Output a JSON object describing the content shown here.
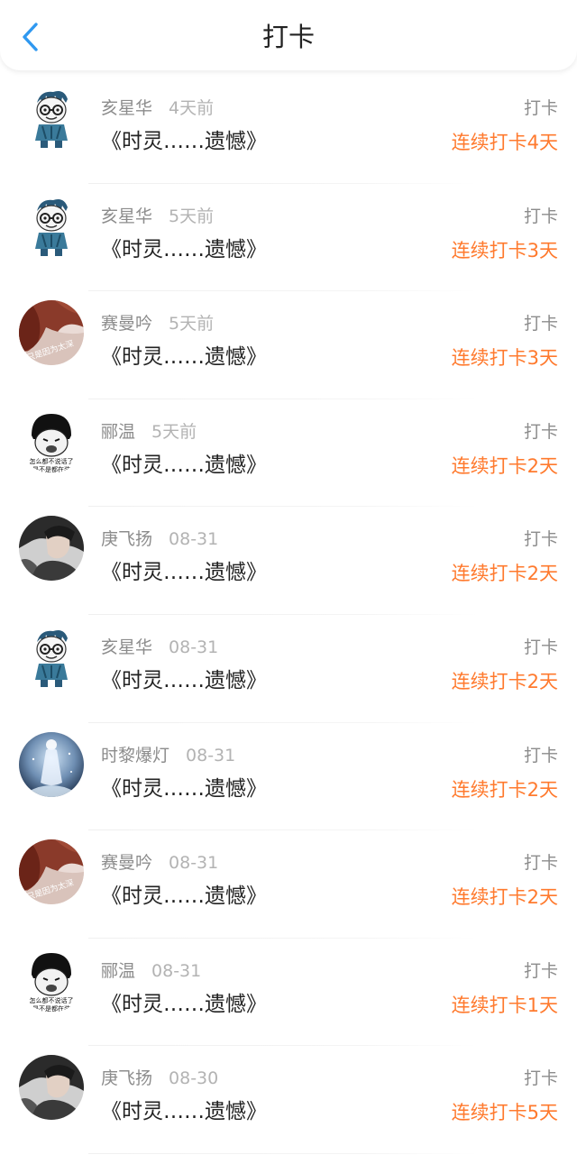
{
  "header": {
    "title": "打卡",
    "back_icon": "chevron-left-icon",
    "accent": "#2f98f0"
  },
  "colors": {
    "streak": "#ff7a2e",
    "name": "#8c8c8c",
    "time": "#b3b3b3"
  },
  "items": [
    {
      "name": "亥星华",
      "time": "4天前",
      "book": "《时灵……遗憾》",
      "action": "打卡",
      "streak": "连续打卡4天",
      "avatar": "cartoon-boy"
    },
    {
      "name": "亥星华",
      "time": "5天前",
      "book": "《时灵……遗憾》",
      "action": "打卡",
      "streak": "连续打卡3天",
      "avatar": "cartoon-boy"
    },
    {
      "name": "赛曼吟",
      "time": "5天前",
      "book": "《时灵……遗憾》",
      "action": "打卡",
      "streak": "连续打卡3天",
      "avatar": "red-hair"
    },
    {
      "name": "郦温",
      "time": "5天前",
      "book": "《时灵……遗憾》",
      "action": "打卡",
      "streak": "连续打卡2天",
      "avatar": "meme-face"
    },
    {
      "name": "庚飞扬",
      "time": "08-31",
      "book": "《时灵……遗憾》",
      "action": "打卡",
      "streak": "连续打卡2天",
      "avatar": "dark-portrait"
    },
    {
      "name": "亥星华",
      "time": "08-31",
      "book": "《时灵……遗憾》",
      "action": "打卡",
      "streak": "连续打卡2天",
      "avatar": "cartoon-boy"
    },
    {
      "name": "时黎爆灯",
      "time": "08-31",
      "book": "《时灵……遗憾》",
      "action": "打卡",
      "streak": "连续打卡2天",
      "avatar": "ghost-figure"
    },
    {
      "name": "赛曼吟",
      "time": "08-31",
      "book": "《时灵……遗憾》",
      "action": "打卡",
      "streak": "连续打卡2天",
      "avatar": "red-hair"
    },
    {
      "name": "郦温",
      "time": "08-31",
      "book": "《时灵……遗憾》",
      "action": "打卡",
      "streak": "连续打卡1天",
      "avatar": "meme-face"
    },
    {
      "name": "庚飞扬",
      "time": "08-30",
      "book": "《时灵……遗憾》",
      "action": "打卡",
      "streak": "连续打卡5天",
      "avatar": "dark-portrait"
    }
  ]
}
